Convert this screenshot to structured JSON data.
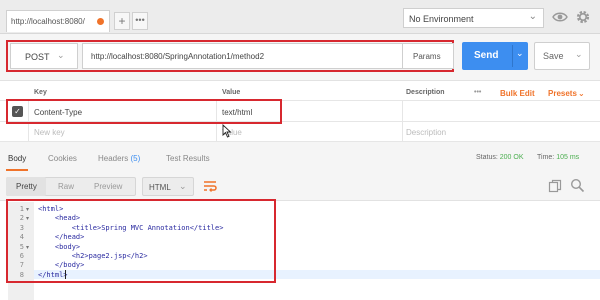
{
  "tabs": {
    "active_title": "http://localhost:8080/",
    "add_label": "+",
    "more_label": "•••"
  },
  "environment": {
    "selected": "No Environment"
  },
  "request": {
    "method": "POST",
    "url": "http://localhost:8080/SpringAnnotation1/method2",
    "params_label": "Params",
    "send_label": "Send",
    "save_label": "Save"
  },
  "headers": {
    "columns": {
      "key": "Key",
      "value": "Value",
      "description": "Description"
    },
    "bulk_edit": "Bulk Edit",
    "presets": "Presets",
    "more": "•••",
    "rows": [
      {
        "enabled": true,
        "key": "Content-Type",
        "value": "text/html",
        "description": ""
      }
    ],
    "new_key_placeholder": "New key",
    "value_placeholder": "Value",
    "description_placeholder": "Description"
  },
  "response": {
    "tabs": {
      "body": "Body",
      "cookies": "Cookies",
      "headers": "Headers",
      "headers_count": "(5)",
      "test_results": "Test Results"
    },
    "status_label": "Status:",
    "status_value": "200 OK",
    "time_label": "Time:",
    "time_value": "105 ms",
    "views": {
      "pretty": "Pretty",
      "raw": "Raw",
      "preview": "Preview"
    },
    "format": "HTML",
    "code_lines": [
      {
        "no": "1",
        "indent": "",
        "text": "<html>"
      },
      {
        "no": "2",
        "indent": "    ",
        "text": "<head>"
      },
      {
        "no": "3",
        "indent": "        ",
        "text": "<title>Spring MVC Annotation</title>"
      },
      {
        "no": "4",
        "indent": "    ",
        "text": "</head>"
      },
      {
        "no": "5",
        "indent": "    ",
        "text": "<body>"
      },
      {
        "no": "6",
        "indent": "        ",
        "text": "<h2>page2.jsp</h2>"
      },
      {
        "no": "7",
        "indent": "    ",
        "text": "</body>"
      },
      {
        "no": "8",
        "indent": "",
        "text": "</html>"
      }
    ]
  },
  "colors": {
    "accent": "#f0732a",
    "send": "#3d8ef0",
    "highlight_box": "#d7282f",
    "status_ok": "#4caf50"
  },
  "icons": [
    "eye-icon",
    "gear-icon",
    "chevron-down-icon",
    "checkbox-checked-icon",
    "wrap-text-icon",
    "copy-icon",
    "search-icon",
    "mouse-cursor-icon"
  ]
}
